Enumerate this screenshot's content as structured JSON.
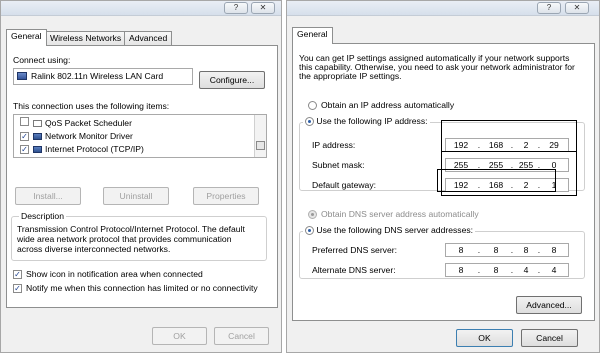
{
  "title_buttons": {
    "help": "?",
    "close": "✕"
  },
  "left": {
    "tabs": [
      "General",
      "Wireless Networks",
      "Advanced"
    ],
    "connect_using_label": "Connect using:",
    "adapter_name": "Ralink 802.11n Wireless LAN Card",
    "configure_button": "Configure...",
    "items_label": "This connection uses the following items:",
    "items": [
      {
        "label": "QoS Packet Scheduler",
        "checked": false
      },
      {
        "label": "Network Monitor Driver",
        "checked": true
      },
      {
        "label": "Internet Protocol (TCP/IP)",
        "checked": true
      }
    ],
    "install_button": "Install...",
    "uninstall_button": "Uninstall",
    "properties_button": "Properties",
    "description_legend": "Description",
    "description_text": [
      "Transmission Control Protocol/Internet Protocol. The default",
      "wide area network protocol that provides communication",
      "across diverse interconnected networks."
    ],
    "show_icon_label": "Show icon in notification area when connected",
    "notify_label": "Notify me when this connection has limited or no connectivity",
    "show_icon_checked": true,
    "notify_checked": true,
    "ok_button": "OK",
    "cancel_button": "Cancel"
  },
  "right": {
    "tab": "General",
    "intro_text": [
      "You can get IP settings assigned automatically if your network supports",
      "this capability. Otherwise, you need to ask your network administrator for",
      "the appropriate IP settings."
    ],
    "obtain_ip_auto": "Obtain an IP address automatically",
    "use_following_ip": "Use the following IP address:",
    "ip_label": "IP address:",
    "subnet_label": "Subnet mask:",
    "gateway_label": "Default gateway:",
    "ip_address": [
      "192",
      "168",
      "2",
      "29"
    ],
    "subnet_mask": [
      "255",
      "255",
      "255",
      "0"
    ],
    "default_gateway": [
      "192",
      "168",
      "2",
      "1"
    ],
    "obtain_dns_auto": "Obtain DNS server address automatically",
    "use_following_dns": "Use the following DNS server addresses:",
    "preferred_dns_label": "Preferred DNS server:",
    "alternate_dns_label": "Alternate DNS server:",
    "preferred_dns": [
      "8",
      "8",
      "8",
      "8"
    ],
    "alternate_dns": [
      "8",
      "8",
      "4",
      "4"
    ],
    "advanced_button": "Advanced...",
    "ok_button": "OK",
    "cancel_button": "Cancel",
    "octet_separator": "."
  }
}
